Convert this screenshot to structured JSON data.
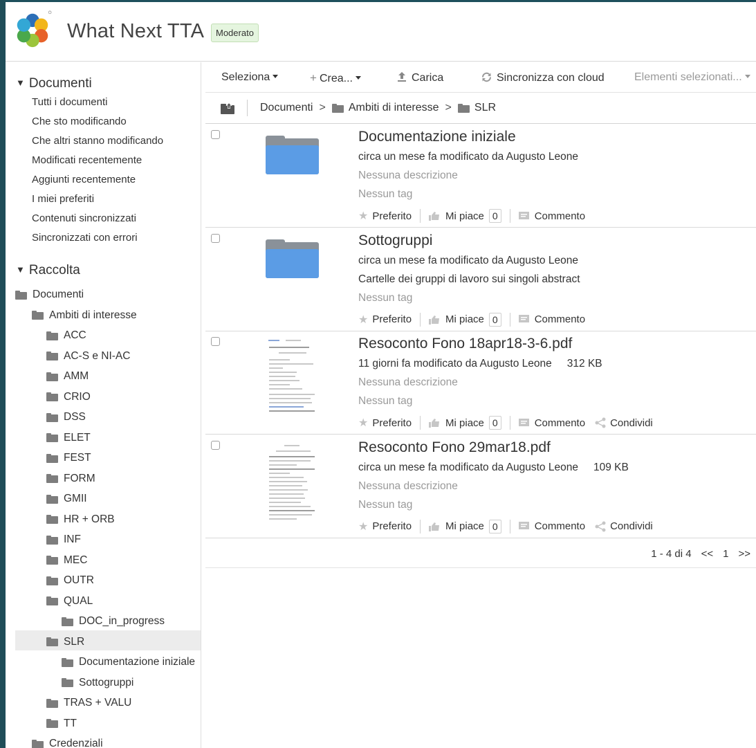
{
  "header": {
    "site_title": "What Next TTA",
    "badge": "Moderato"
  },
  "sidebar": {
    "documents_heading": "Documenti",
    "filters": [
      "Tutti i documenti",
      "Che sto modificando",
      "Che altri stanno modificando",
      "Modificati recentemente",
      "Aggiunti recentemente",
      "I miei preferiti",
      "Contenuti sincronizzati",
      "Sincronizzati con errori"
    ],
    "library_heading": "Raccolta",
    "tree": [
      {
        "label": "Documenti",
        "level": 0
      },
      {
        "label": "Ambiti di interesse",
        "level": 1
      },
      {
        "label": "ACC",
        "level": 2
      },
      {
        "label": "AC-S e NI-AC",
        "level": 2
      },
      {
        "label": "AMM",
        "level": 2
      },
      {
        "label": "CRIO",
        "level": 2
      },
      {
        "label": "DSS",
        "level": 2
      },
      {
        "label": "ELET",
        "level": 2
      },
      {
        "label": "FEST",
        "level": 2
      },
      {
        "label": "FORM",
        "level": 2
      },
      {
        "label": "GMII",
        "level": 2
      },
      {
        "label": "HR + ORB",
        "level": 2
      },
      {
        "label": "INF",
        "level": 2
      },
      {
        "label": "MEC",
        "level": 2
      },
      {
        "label": "OUTR",
        "level": 2
      },
      {
        "label": "QUAL",
        "level": 2
      },
      {
        "label": "DOC_in_progress",
        "level": 3
      },
      {
        "label": "SLR",
        "level": 2,
        "selected": true
      },
      {
        "label": "Documentazione iniziale",
        "level": 3
      },
      {
        "label": "Sottogruppi",
        "level": 3
      },
      {
        "label": "TRAS + VALU",
        "level": 2
      },
      {
        "label": "TT",
        "level": 2
      },
      {
        "label": "Credenziali",
        "level": 1
      }
    ]
  },
  "toolbar": {
    "select_label": "Seleziona",
    "create_label": "Crea...",
    "upload_label": "Carica",
    "sync_label": "Sincronizza con cloud",
    "selected_items_label": "Elementi selezionati..."
  },
  "breadcrumb": {
    "root": "Documenti",
    "sep": ">",
    "items": [
      "Ambiti di interesse",
      "SLR"
    ]
  },
  "documents": [
    {
      "type": "folder",
      "title": "Documentazione iniziale",
      "modified": "circa un mese fa modificato da Augusto Leone",
      "size": "",
      "description": "Nessuna descrizione",
      "description_empty": true,
      "tags": "Nessun tag",
      "favorite_label": "Preferito",
      "like_label": "Mi piace",
      "like_count": "0",
      "comment_label": "Commento",
      "share_label": ""
    },
    {
      "type": "folder",
      "title": "Sottogruppi",
      "modified": "circa un mese fa modificato da Augusto Leone",
      "size": "",
      "description": "Cartelle dei gruppi di lavoro sui singoli abstract",
      "description_empty": false,
      "tags": "Nessun tag",
      "favorite_label": "Preferito",
      "like_label": "Mi piace",
      "like_count": "0",
      "comment_label": "Commento",
      "share_label": ""
    },
    {
      "type": "pdf",
      "title": "Resoconto Fono 18apr18-3-6.pdf",
      "modified": "11 giorni fa modificato da Augusto Leone",
      "size": "312 KB",
      "description": "Nessuna descrizione",
      "description_empty": true,
      "tags": "Nessun tag",
      "favorite_label": "Preferito",
      "like_label": "Mi piace",
      "like_count": "0",
      "comment_label": "Commento",
      "share_label": "Condividi"
    },
    {
      "type": "pdf",
      "title": "Resoconto Fono 29mar18.pdf",
      "modified": "circa un mese fa modificato da Augusto Leone",
      "size": "109 KB",
      "description": "Nessuna descrizione",
      "description_empty": true,
      "tags": "Nessun tag",
      "favorite_label": "Preferito",
      "like_label": "Mi piace",
      "like_count": "0",
      "comment_label": "Commento",
      "share_label": "Condividi"
    }
  ],
  "pagination": {
    "range": "1 - 4 di 4",
    "prev": "<<",
    "page": "1",
    "next": ">>"
  },
  "colors": {
    "frame_border": "#1e4f5c",
    "folder_blue": "#5b9ce5",
    "badge_bg": "#e5f5df",
    "selected_row": "#ececec"
  },
  "icons": {
    "logo": "flower-logo",
    "favorite": "star-icon",
    "like": "thumbs-up-icon",
    "comment": "comment-icon",
    "share": "share-icon",
    "upload": "upload-icon",
    "sync": "sync-icon",
    "create": "plus-icon",
    "folder": "folder-icon",
    "parent": "folder-up-icon"
  }
}
